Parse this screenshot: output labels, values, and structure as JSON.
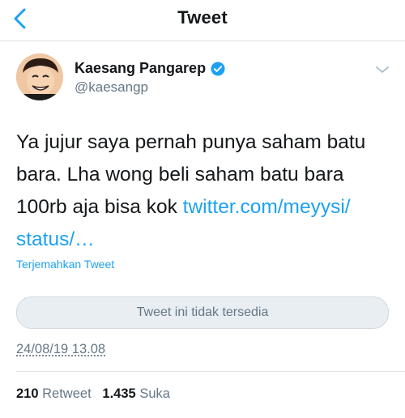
{
  "header": {
    "title": "Tweet"
  },
  "author": {
    "name": "Kaesang Pangarep",
    "handle": "@kaesangp"
  },
  "tweet": {
    "lines": [
      "Ya jujur saya pernah punya saham batu",
      "bara. Lha wong beli saham batu bara"
    ],
    "line3": "100rb aja bisa kok ",
    "link_part1": "twitter.com/meyysi/",
    "link_part2": "status/…",
    "translate_label": "Terjemahkan Tweet"
  },
  "quoted": {
    "unavailable_text": "Tweet ini tidak tersedia"
  },
  "timestamp": "24/08/19 13.08",
  "stats": {
    "retweet_count": "210",
    "retweet_label": "Retweet",
    "like_count": "1.435",
    "like_label": "Suka"
  },
  "colors": {
    "accent": "#1da1f2",
    "secondary": "#657786"
  }
}
